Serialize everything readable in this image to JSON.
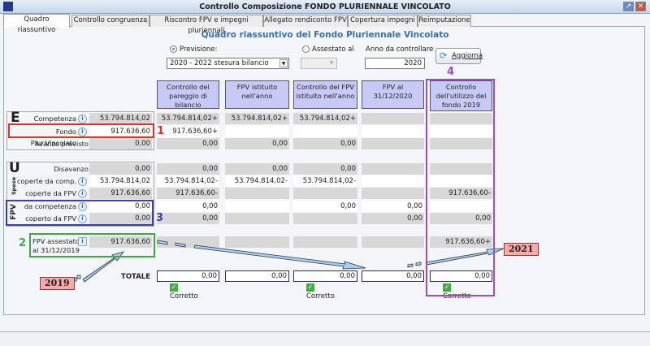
{
  "window": {
    "title": "Controllo Composizione FONDO PLURIENNALE VINCOLATO"
  },
  "tabs": [
    "Quadro riassuntivo",
    "Controllo congruenza",
    "Riscontro FPV e impegni pluriennali",
    "Allegato rendiconto FPV",
    "Copertura impegni",
    "Reimputazione"
  ],
  "heading": "Quadro riassuntivo del Fondo Pluriennale Vincolato",
  "controls": {
    "previsione_label": "Previsione:",
    "previsione_value": "2020 - 2022 stesura bilancio",
    "assestato_label": "Assestato al",
    "assestato_value": "",
    "anno_label": "Anno da controllare",
    "anno_value": "2020",
    "aggiorna_label": "Aggiorna"
  },
  "columns": [
    "Controllo del pareggio di bilancio",
    "FPV istituito nell'anno",
    "Controllo del FPV istituito nell'anno",
    "FPV al 31/12/2020",
    "Controllo dell'utilizzo del fondo 2019"
  ],
  "sections": {
    "entrate": "E",
    "uscite": "U",
    "spese": "Spese",
    "fpv": "FPV"
  },
  "rows": [
    {
      "label": "Competenza",
      "info": true,
      "values": [
        "53.794.814,02",
        "53.794.814,02+",
        "53.794.814,02+",
        "53.794.814,02+",
        "",
        ""
      ]
    },
    {
      "label": "Fondo Plur.Vincolato",
      "info": true,
      "values": [
        "917.636,60",
        "917.636,60+",
        "",
        "",
        "",
        ""
      ]
    },
    {
      "label": "Avanzo previsto",
      "info": false,
      "values": [
        "0,00",
        "0,00",
        "0,00",
        "0,00",
        "",
        ""
      ]
    },
    {
      "label": "Disavanzo",
      "info": false,
      "values": [
        "0,00",
        "0,00",
        "0,00",
        "0,00",
        "",
        ""
      ]
    },
    {
      "label": "coperte da comp.",
      "info": true,
      "values": [
        "53.794.814,02",
        "53.794.814,02-",
        "53.794.814,02-",
        "53.794.814,02-",
        "",
        ""
      ]
    },
    {
      "label": "coperte da FPV",
      "info": true,
      "values": [
        "917.636,60",
        "917.636,60-",
        "",
        "",
        "",
        "917.636,60-"
      ]
    },
    {
      "label": "da competenza",
      "info": true,
      "values": [
        "0,00",
        "0,00",
        "",
        "0,00",
        "0,00",
        ""
      ]
    },
    {
      "label": "coperto da FPV",
      "info": true,
      "values": [
        "0,00",
        "0,00",
        "",
        "",
        "0,00",
        "0,00"
      ]
    }
  ],
  "fpv_assestato": {
    "label1": "FPV assestato",
    "label2": "al 31/12/2019",
    "values": [
      "917.636,60",
      "",
      "",
      "",
      "",
      "917.636,60+"
    ]
  },
  "totale": {
    "label": "TOTALE",
    "values": [
      "0,00",
      "0,00",
      "0,00",
      "0,00",
      "0,00"
    ],
    "status": [
      "Corretto",
      "",
      "Corretto",
      "",
      "Corretto"
    ]
  },
  "annotations": {
    "n1": "1",
    "n2": "2",
    "n3": "3",
    "n4": "4",
    "y2019": "2019",
    "y2021": "2021"
  },
  "colors": {
    "n1": "#e03030",
    "n2": "#3aaa4a",
    "n3": "#3b3fb0",
    "n4": "#a050b0"
  }
}
